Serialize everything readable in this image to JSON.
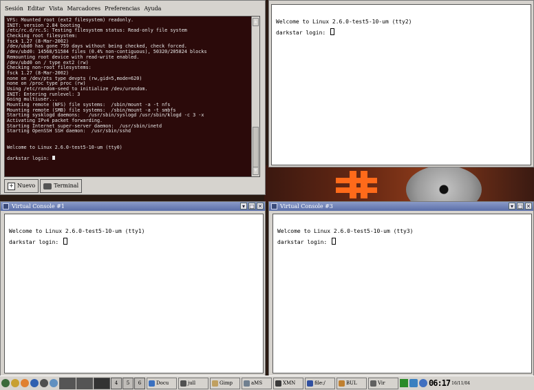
{
  "gnome_terminal": {
    "menu": [
      "Sesión",
      "Editar",
      "Vista",
      "Marcadores",
      "Preferencias",
      "Ayuda"
    ],
    "lines": [
      "VFS: Mounted root (ext2 filesystem) readonly.",
      "INIT: version 2.84 booting",
      "/etc/rc.d/rc.S: Testing filesystem status: Read-only file system",
      "Checking root filesystem:",
      "fsck 1.27 (8-Mar-2002)",
      "/dev/ubd0 has gone 759 days without being checked, check forced.",
      "/dev/ubd0: 14568/51584 files (0.4% non-contiguous), 50320/205824 blocks",
      "Remounting root device with read-write enabled.",
      "/dev/ubd0 on / type ext2 (rw)",
      "Checking non-root filesystems:",
      "fsck 1.27 (8-Mar-2002)",
      "none on /dev/pts type devpts (rw,gid=5,mode=620)",
      "none on /proc type proc (rw)",
      "Using /etc/random-seed to initialize /dev/urandom.",
      "INIT: Entering runlevel: 3",
      "Going multiuser...",
      "Mounting remote (NFS) file systems:  /sbin/mount -a -t nfs",
      "Mounting remote (SMB) file systems:  /sbin/mount -a -t smbfs",
      "Starting sysklogd daemons:   /usr/sbin/syslogd /usr/sbin/klogd -c 3 -x",
      "Activating IPv4 packet forwarding.",
      "Starting Internet super-server daemon:  /usr/sbin/inetd",
      "Starting OpenSSH SSH daemon:  /usr/sbin/sshd",
      "",
      "",
      "Welcome to Linux 2.6.0-test5-10-um (tty0)",
      "",
      "darkstar login: "
    ],
    "tab_new": "Nuevo",
    "tab_terminal": "Terminal"
  },
  "consoles": {
    "tty2": {
      "title": "",
      "welcome": "Welcome to Linux 2.6.0-test5-10-um (tty2)",
      "login": "darkstar login: "
    },
    "tty1": {
      "title": "Virtual Console #1",
      "welcome": "Welcome to Linux 2.6.0-test5-10-um (tty1)",
      "login": "darkstar login: "
    },
    "tty3": {
      "title": "Virtual Console #3",
      "welcome": "Welcome to Linux 2.6.0-test5-10-um (tty3)",
      "login": "darkstar login: "
    }
  },
  "taskbar": {
    "pager": [
      "4",
      "5",
      "6"
    ],
    "tasks": [
      "Docu",
      "jull",
      "Gimp",
      "aMS",
      "XMN",
      "file:/",
      "BUL",
      "Vir"
    ],
    "clock": "06:17",
    "date": "16/11/04"
  },
  "colors": {
    "terminal_bg": "#2b0a0a",
    "titlebar": "#5a6ea8",
    "accent": "#ff6a1a"
  }
}
